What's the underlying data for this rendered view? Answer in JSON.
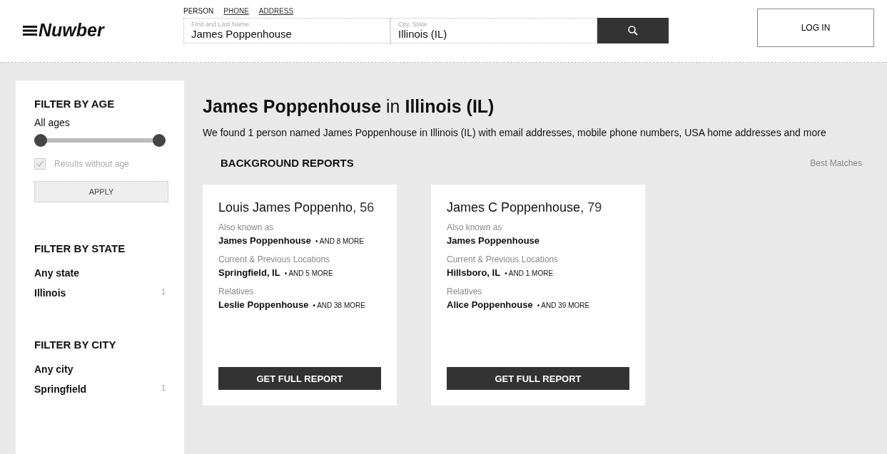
{
  "logo": "Nuwber",
  "search_tabs": [
    {
      "label": "PERSON",
      "selected": true
    },
    {
      "label": "PHONE",
      "selected": false
    },
    {
      "label": "ADDRESS",
      "selected": false
    }
  ],
  "search": {
    "fields": [
      {
        "label": "First and Last Name",
        "value": "James Poppenhouse"
      },
      {
        "label": "City, State",
        "value": "Illinois (IL)"
      }
    ]
  },
  "login": "LOG IN",
  "sidebar": {
    "age": {
      "title": "FILTER BY AGE",
      "label": "All ages",
      "level": 1,
      "checkbox": {
        "label": "Results without age",
        "checked": true,
        "disabled": true
      },
      "apply": "APPLY"
    },
    "groups": [
      {
        "title": "FILTER BY STATE",
        "items": [
          {
            "label": "Any state"
          },
          {
            "label": "Illinois",
            "count": "1"
          }
        ]
      },
      {
        "title": "FILTER BY CITY",
        "items": [
          {
            "label": "Any city"
          },
          {
            "label": "Springfield",
            "count": "1"
          }
        ]
      }
    ]
  },
  "heading": "**James Poppenhouse** in **Illinois (IL)**",
  "summary": "We found 1 person named James Poppenhouse in Illinois (IL) with email addresses, mobile phone numbers, USA home addresses and more",
  "section_title": "BACKGROUND REPORTS",
  "sort": "Best Matches",
  "cards": [
    {
      "name": "Louis James Poppenho",
      "age": ", 56",
      "sections": [
        {
          "label": "Also known as",
          "value": "James Poppenhouse",
          "more": "• AND 8 MORE"
        },
        {
          "label": "Current & Previous Locations",
          "value": "Springfield, IL",
          "more": "• AND 5 MORE"
        },
        {
          "label": "Relatives",
          "value": "Leslie Poppenhouse",
          "more": "• AND 38 MORE"
        }
      ],
      "button": "GET FULL REPORT"
    },
    {
      "name": "James C Poppenhouse",
      "age": ", 79",
      "sections": [
        {
          "label": "Also known as",
          "value": "James Poppenhouse"
        },
        {
          "label": "Current & Previous Locations",
          "value": "Hillsboro, IL",
          "more": "• AND 1 MORE"
        },
        {
          "label": "Relatives",
          "value": "Alice Poppenhouse",
          "more": "• AND 39 MORE"
        }
      ],
      "button": "GET FULL REPORT"
    }
  ]
}
